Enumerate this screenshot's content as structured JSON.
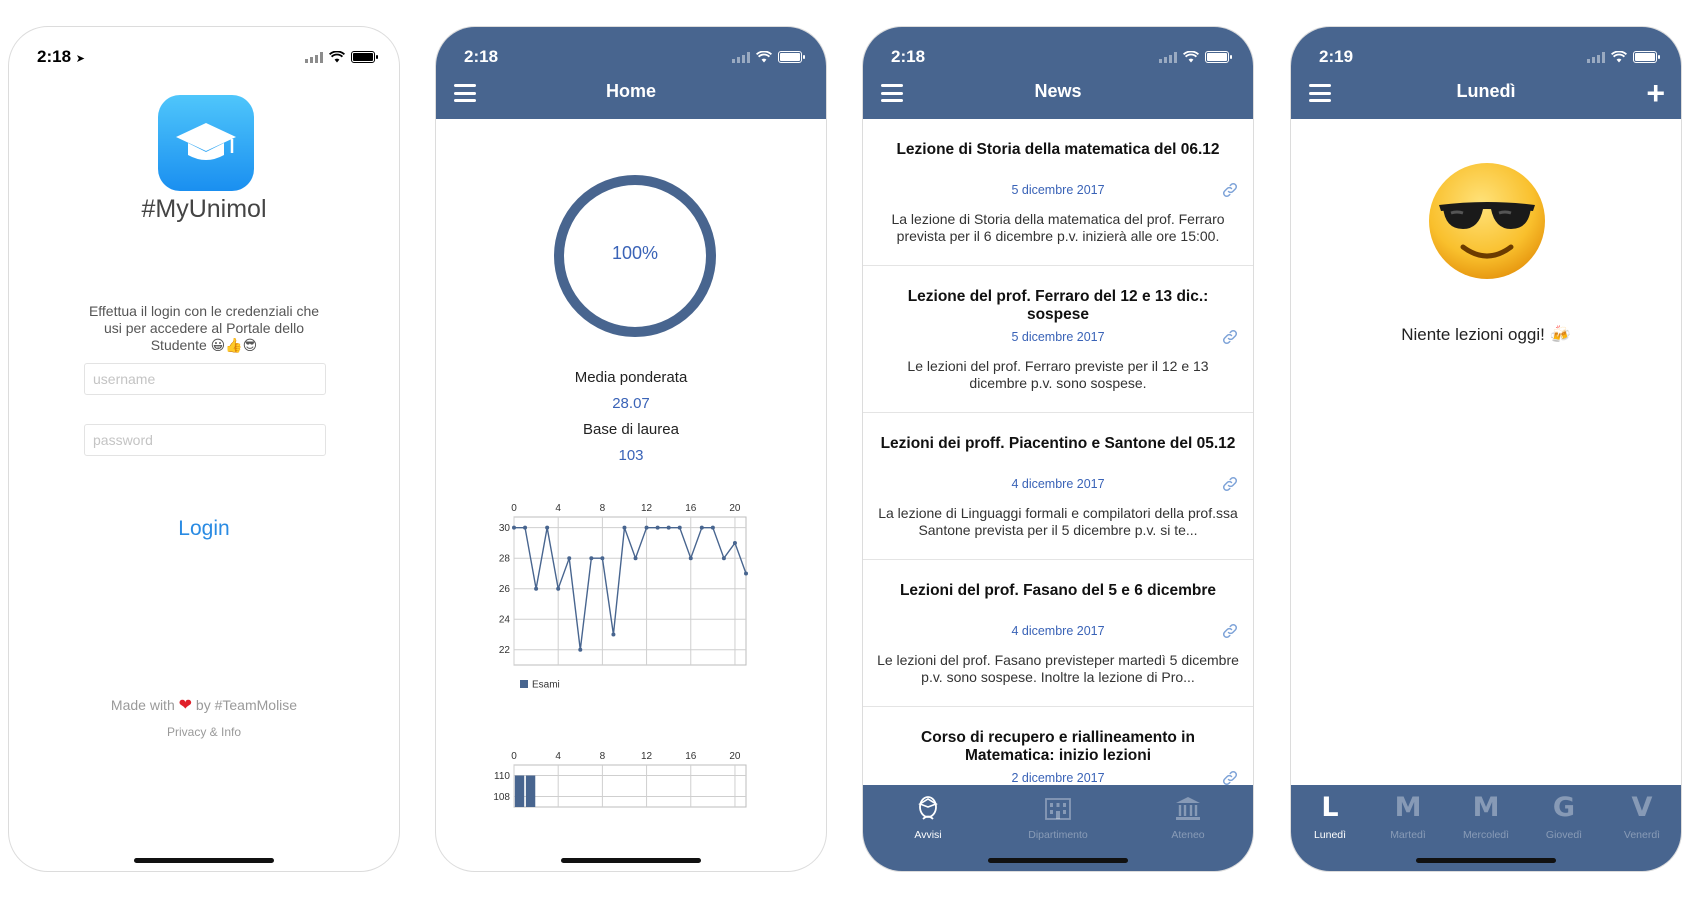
{
  "screens": {
    "login": {
      "time": "2:18",
      "app_name": "#MyUnimol",
      "message": "Effettua il login con le credenziali che usi per accedere al Portale dello Studente 😀👍😎",
      "username_placeholder": "username",
      "password_placeholder": "password",
      "login_label": "Login",
      "made_with_prefix": "Made with",
      "made_with_suffix": "by #TeamMolise",
      "privacy_label": "Privacy & Info"
    },
    "home": {
      "time": "2:18",
      "title": "Home",
      "progress_percent": 100,
      "progress_label": "100%",
      "weighted_average_label": "Media ponderata",
      "weighted_average_value": "28.07",
      "graduation_base_label": "Base di laurea",
      "graduation_base_value": "103",
      "accent_color": "#48658f"
    },
    "news": {
      "time": "2:18",
      "title": "News",
      "items": [
        {
          "title": "Lezione di Storia della matematica del 06.12",
          "date": "5 dicembre 2017",
          "text": "La lezione di Storia della matematica del prof. Ferraro prevista per il 6 dicembre p.v. inizierà alle ore 15:00."
        },
        {
          "title": "Lezione del prof. Ferraro del 12 e 13 dic.: sospese",
          "date": "5 dicembre 2017",
          "text": "Le lezioni del prof. Ferraro previste per il 12 e 13 dicembre p.v. sono sospese."
        },
        {
          "title": "Lezioni dei proff. Piacentino e Santone del 05.12",
          "date": "4 dicembre 2017",
          "text": "La lezione di Linguaggi formali e compilatori della prof.ssa Santone prevista per il 5 dicembre p.v. si te..."
        },
        {
          "title": "Lezioni del prof. Fasano del 5 e 6 dicembre",
          "date": "4 dicembre 2017",
          "text": "Le lezioni del prof. Fasano previsteper  martedì 5 dicembre p.v. sono sospese. Inoltre la lezione di Pro..."
        },
        {
          "title": "Corso di recupero e riallineamento in Matematica: inizio lezioni",
          "date": "2 dicembre 2017",
          "text": ""
        }
      ],
      "tabs": [
        {
          "label": "Avvisi",
          "icon": "student-icon",
          "active": true
        },
        {
          "label": "Dipartimento",
          "icon": "building-icon",
          "active": false
        },
        {
          "label": "Ateneo",
          "icon": "institution-icon",
          "active": false
        }
      ]
    },
    "lunedi": {
      "time": "2:19",
      "title": "Lunedì",
      "empty_message": "Niente lezioni oggi! 🍻",
      "face_icon": "sunglasses-face-icon",
      "days": [
        {
          "letter": "L",
          "label": "Lunedì",
          "active": true
        },
        {
          "letter": "M",
          "label": "Martedì",
          "active": false
        },
        {
          "letter": "M",
          "label": "Mercoledì",
          "active": false
        },
        {
          "letter": "G",
          "label": "Giovedì",
          "active": false
        },
        {
          "letter": "V",
          "label": "Venerdì",
          "active": false
        }
      ]
    }
  },
  "chart_data": [
    {
      "type": "line",
      "title": "",
      "legend": [
        "Esami"
      ],
      "legend_position": "bottom-left",
      "x_ticks": [
        0,
        4,
        8,
        12,
        16,
        20
      ],
      "y_ticks": [
        22,
        24,
        26,
        28,
        30
      ],
      "xlim": [
        0,
        21
      ],
      "ylim": [
        21,
        30.7
      ],
      "grid": true,
      "series": [
        {
          "name": "Esami",
          "x": [
            0,
            1,
            2,
            3,
            4,
            5,
            6,
            7,
            8,
            9,
            10,
            11,
            12,
            13,
            14,
            15,
            16,
            17,
            18,
            19,
            20,
            21
          ],
          "y": [
            30,
            30,
            26,
            30,
            26,
            28,
            22,
            28,
            28,
            23,
            30,
            28,
            30,
            30,
            30,
            30,
            28,
            30,
            30,
            28,
            29,
            27
          ]
        }
      ]
    },
    {
      "type": "bar",
      "title": "",
      "x_ticks": [
        0,
        4,
        8,
        12,
        16,
        20
      ],
      "y_ticks": [
        108,
        110
      ],
      "xlim": [
        0,
        21
      ],
      "ylim": [
        107,
        111
      ],
      "grid": true,
      "series": [
        {
          "x": [
            0.5,
            1.5
          ],
          "values": [
            110,
            110
          ]
        }
      ]
    }
  ]
}
